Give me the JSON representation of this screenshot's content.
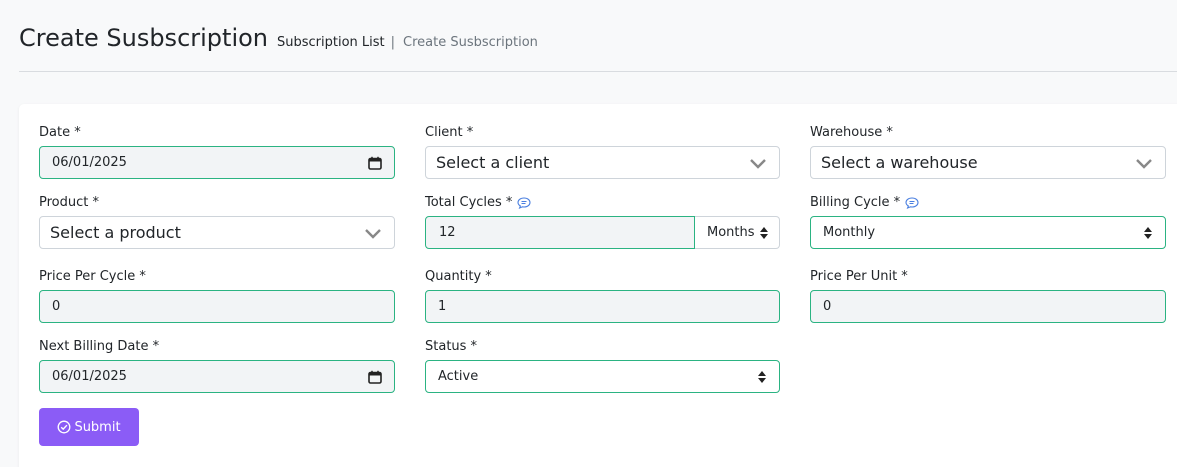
{
  "header": {
    "title": "Create Susbscription",
    "breadcrumb_link": "Subscription List",
    "breadcrumb_separator": "|",
    "breadcrumb_current": "Create Susbscription"
  },
  "form": {
    "date": {
      "label": "Date *",
      "value": "06/01/2025"
    },
    "client": {
      "label": "Client *",
      "placeholder": "Select a client"
    },
    "warehouse": {
      "label": "Warehouse *",
      "placeholder": "Select a warehouse"
    },
    "product": {
      "label": "Product *",
      "placeholder": "Select a product"
    },
    "total_cycles": {
      "label": "Total Cycles *",
      "value": "12",
      "unit": "Months"
    },
    "billing_cycle": {
      "label": "Billing Cycle *",
      "value": "Monthly"
    },
    "price_per_cycle": {
      "label": "Price Per Cycle *",
      "value": "0"
    },
    "quantity": {
      "label": "Quantity *",
      "value": "1"
    },
    "price_per_unit": {
      "label": "Price Per Unit *",
      "value": "0"
    },
    "next_billing_date": {
      "label": "Next Billing Date *",
      "value": "06/01/2025"
    },
    "status": {
      "label": "Status *",
      "value": "Active"
    },
    "submit_label": "Submit"
  },
  "colors": {
    "accent_border": "#2bb382",
    "submit_button": "#8b5cf6",
    "info_icon": "#4a7fe0"
  },
  "icons": [
    "calendar-icon",
    "chevron-down-icon",
    "sort-arrows-icon",
    "info-bubble-icon",
    "check-circle-icon"
  ]
}
